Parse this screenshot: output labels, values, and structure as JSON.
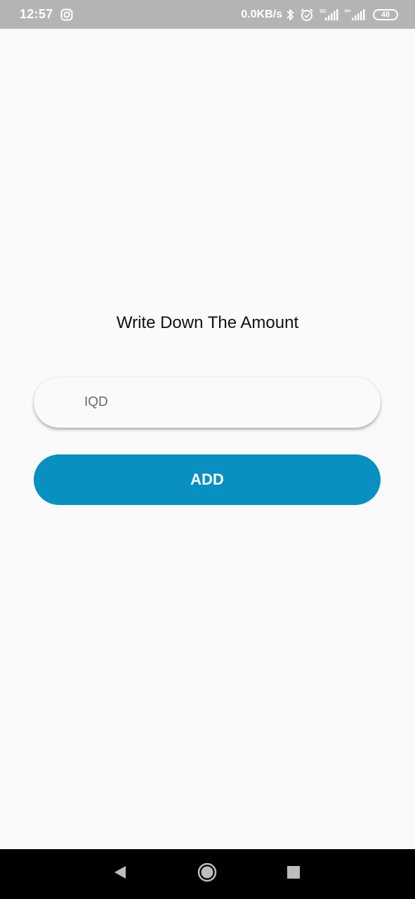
{
  "status_bar": {
    "time": "12:57",
    "network_speed": "0.0KB/s",
    "network_1": "3G",
    "network_2": "H+",
    "battery": "48",
    "icons": [
      "instagram-icon",
      "bluetooth-icon",
      "alarm-icon",
      "signal-icon",
      "signal-icon",
      "battery-icon"
    ]
  },
  "main": {
    "title": "Write Down The Amount",
    "amount_input": {
      "value": "",
      "placeholder": "IQD"
    },
    "add_button_label": "ADD"
  },
  "nav_bar": {
    "icons": [
      "back-icon",
      "home-icon",
      "recents-icon"
    ]
  },
  "colors": {
    "background": "#fafafa",
    "status_bar": "#b4b4b4",
    "accent": "#0790c0",
    "nav_bar": "#000000"
  }
}
